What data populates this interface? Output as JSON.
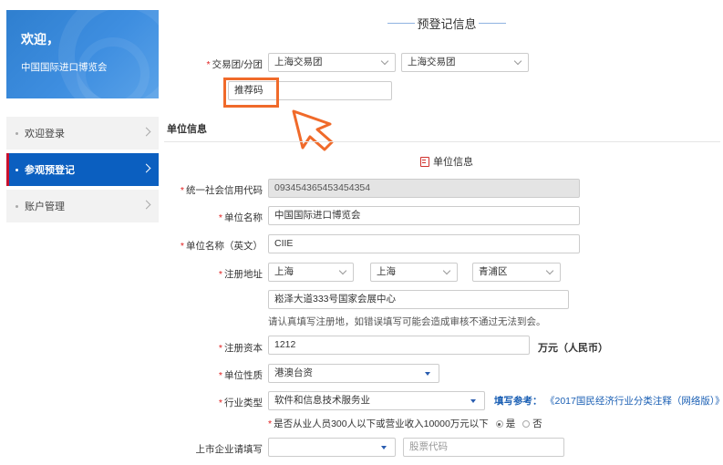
{
  "banner": {
    "title": "欢迎，",
    "subtitle": "中国国际进口博览会"
  },
  "sidebar": {
    "items": [
      {
        "label": "欢迎登录",
        "active": false
      },
      {
        "label": "参观预登记",
        "active": true
      },
      {
        "label": "账户管理",
        "active": false
      }
    ]
  },
  "section_title": "预登记信息",
  "group": {
    "label": "交易团/分团",
    "select1": "上海交易团",
    "select2": "上海交易团",
    "referral_label": "推荐码",
    "referral_value": ""
  },
  "unit_info_heading": "单位信息",
  "unit_info_center": "单位信息",
  "fields": {
    "credit_code": {
      "label": "统一社会信用代码",
      "value": "093454365453454354"
    },
    "name": {
      "label": "单位名称",
      "value": "中国国际进口博览会"
    },
    "name_en": {
      "label": "单位名称（英文）",
      "value": "CIIE"
    },
    "address": {
      "label": "注册地址",
      "province": "上海",
      "city": "上海",
      "district": "青浦区",
      "detail": "崧泽大道333号国家会展中心",
      "hint": "请认真填写注册地，如错误填写可能会造成审核不通过无法到会。"
    },
    "capital": {
      "label": "注册资本",
      "value": "1212",
      "unit": "万元（人民币）"
    },
    "nature": {
      "label": "单位性质",
      "value": "港澳台资"
    },
    "industry": {
      "label": "行业类型",
      "value": "软件和信息技术服务业",
      "ref_label": "填写参考：",
      "ref_link": "《2017国民经济行业分类注释（网络版）》"
    },
    "small_business": {
      "question": "是否从业人员300人以下或营业收入10000万元以下",
      "yes": "是",
      "no": "否",
      "selected": "是"
    },
    "listed": {
      "label": "上市企业请填写",
      "select": "",
      "stock_placeholder": "股票代码"
    }
  },
  "colors": {
    "primary": "#0b5fc0",
    "highlight": "#f06a2a",
    "required": "#e02020"
  }
}
